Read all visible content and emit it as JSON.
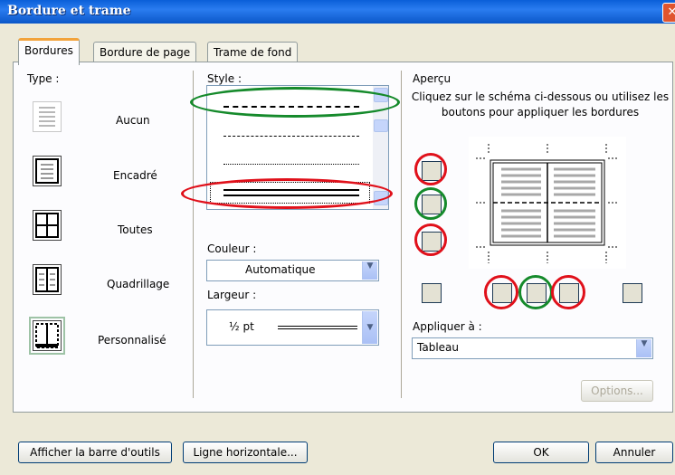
{
  "window": {
    "title": "Bordure et trame",
    "close_glyph": "✕"
  },
  "tabs": [
    {
      "label": "Bordures"
    },
    {
      "label": "Bordure de page"
    },
    {
      "label": "Trame de fond"
    }
  ],
  "type_section": {
    "label": "Type :",
    "items": [
      {
        "label": "Aucun"
      },
      {
        "label": "Encadré"
      },
      {
        "label": "Toutes"
      },
      {
        "label": "Quadrillage"
      },
      {
        "label": "Personnalisé",
        "selected": true
      }
    ]
  },
  "style_section": {
    "label": "Style :",
    "line_styles": [
      "dashed",
      "dash-dot",
      "dash-dot-dot",
      "double"
    ],
    "selected_style": "double"
  },
  "color": {
    "label": "Couleur :",
    "value": "Automatique"
  },
  "width": {
    "label": "Largeur :",
    "value": "½ pt"
  },
  "preview": {
    "label": "Aperçu",
    "hint": "Cliquez sur le schéma ci-dessous ou utilisez les boutons pour appliquer les bordures"
  },
  "apply_to": {
    "label": "Appliquer à :",
    "value": "Tableau"
  },
  "buttons": {
    "options": "Options...",
    "toolbar": "Afficher la barre d'outils",
    "horizontal_line": "Ligne horizontale...",
    "ok": "OK",
    "cancel": "Annuler"
  },
  "annotation_colors": {
    "red": "#e0101a",
    "green": "#158a2b"
  }
}
